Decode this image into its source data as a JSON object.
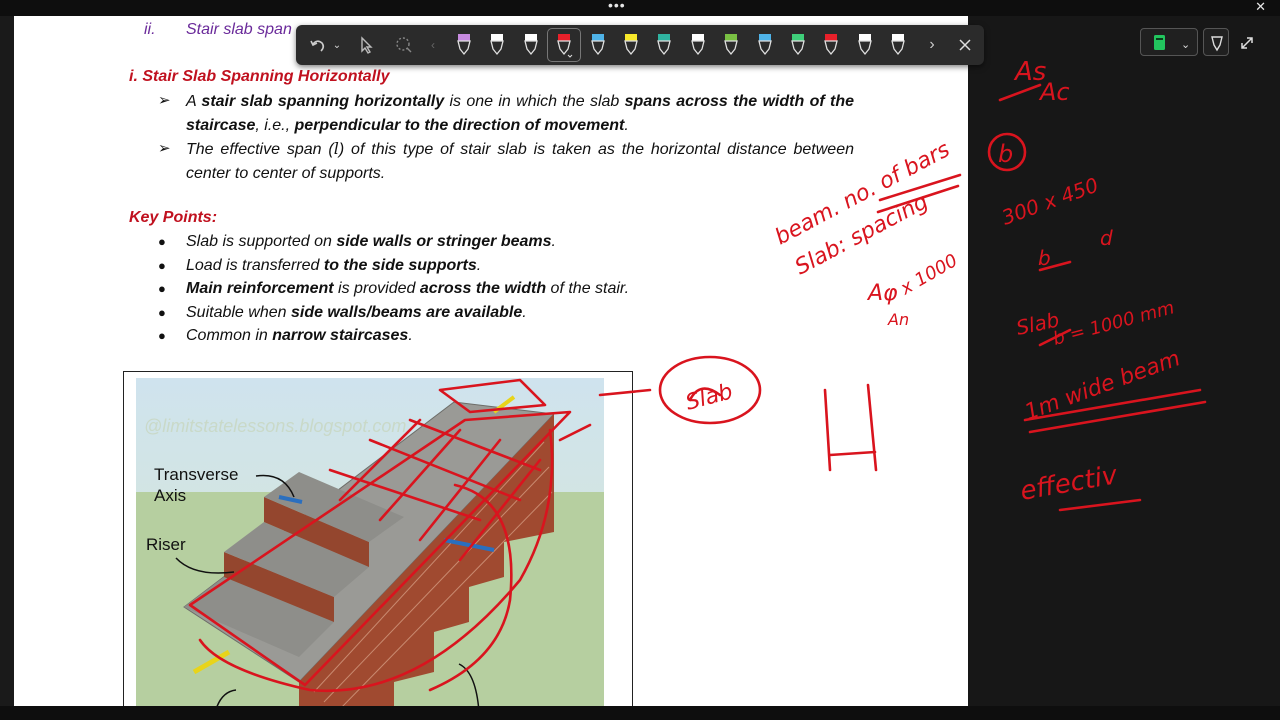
{
  "document": {
    "partial_heading": {
      "numeral": "ii.",
      "text": "Stair slab span"
    },
    "section_title": "i. Stair Slab Spanning Horizontally",
    "para1": {
      "a": "A ",
      "b": "stair slab spanning horizontally",
      "c": " is one in which the slab ",
      "d": "spans across the width of the staircase",
      "e": ", i.e., ",
      "f": "perpendicular to the direction of movement",
      "g": "."
    },
    "para2": {
      "a": "The effective span (",
      "b": "l",
      "c": ") of this type of stair slab is taken as the horizontal distance between center to center of supports."
    },
    "key_points_title": "Key Points:",
    "key_points": [
      {
        "pre": "Slab is supported on ",
        "bold": "side walls or stringer beams",
        "post": "."
      },
      {
        "pre": "Load is transferred ",
        "bold": "to the side supports",
        "post": "."
      },
      {
        "pre": "",
        "bold": "Main reinforcement",
        "mid": " is provided ",
        "bold2": "across the width",
        "post": " of the stair."
      },
      {
        "pre": "Suitable when ",
        "bold": "side walls/beams are available",
        "post": "."
      },
      {
        "pre": "Common in ",
        "bold": "narrow staircases",
        "post": "."
      }
    ],
    "figure": {
      "watermark": "@limitstatelessons.blogspot.com",
      "label_transverse": [
        "Transverse",
        "Axis"
      ],
      "label_riser": "Riser"
    }
  },
  "toolbar": {
    "undo_icon": "undo-icon",
    "select_icon": "pointer-icon",
    "lasso_icon": "lasso-icon",
    "pens": [
      {
        "color": "#c78be0"
      },
      {
        "color": "#ffffff"
      },
      {
        "color": "#ffffff"
      },
      {
        "color": "#e8202a",
        "selected": true
      },
      {
        "color": "#4fb3e8"
      },
      {
        "color": "#f7e82a"
      },
      {
        "color": "#2fb3a0"
      },
      {
        "color": "#ffffff"
      },
      {
        "color": "#79c043"
      },
      {
        "color": "#4fb3e8"
      },
      {
        "color": "#3fcf7a"
      },
      {
        "color": "#e8202a"
      },
      {
        "color": "#ffffff"
      },
      {
        "color": "#ffffff"
      }
    ]
  },
  "handwriting": {
    "a1": "As",
    "a2": "Ac",
    "b": "b",
    "beam_line": "beam. no. of bars",
    "slab_line": "Slab: spacing",
    "dims": "300 x 450",
    "dim_b": "b",
    "dim_d": "d",
    "ratio_top": "Aφ",
    "ratio_bot": "An",
    "ratio_x": "x 1000",
    "slab2": "Slab",
    "b_eq": "b = 1000 mm",
    "wide": "1m wide beam",
    "effect": "effectiv",
    "slab_bubble": "Slab"
  },
  "colors": {
    "ink": "#d9141e",
    "accent": "#c0111f",
    "purple": "#6a2a9a"
  }
}
